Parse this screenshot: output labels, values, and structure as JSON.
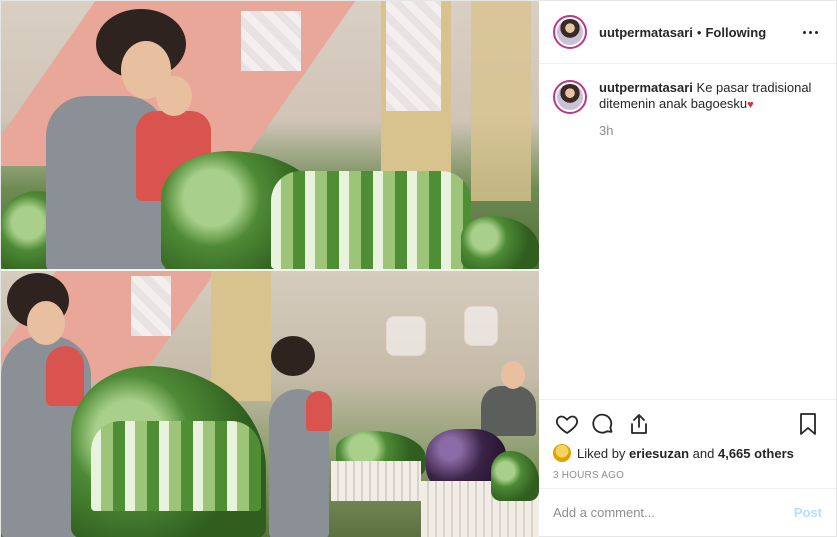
{
  "header": {
    "username": "uutpermatasari",
    "separator": "•",
    "follow_status": "Following",
    "more_icon": "more-horizontal-icon"
  },
  "caption": {
    "username": "uutpermatasari",
    "text": "Ke pasar tradisional ditemenin anak bagoesku",
    "emoji": "heart-icon",
    "time": "3h"
  },
  "actions": {
    "icons": [
      "heart-icon",
      "comment-icon",
      "share-icon",
      "bookmark-icon"
    ]
  },
  "likes": {
    "prefix": "Liked by",
    "liker": "eriesuzan",
    "middle": "and",
    "others": "4,665 others"
  },
  "post_date": "3 HOURS AGO",
  "comment_box": {
    "placeholder": "Add a comment...",
    "post_label": "Post"
  },
  "colors": {
    "text": "#262626",
    "muted": "#8e8e8e",
    "post_disabled": "#b2dffc",
    "border": "#efefef",
    "story_ring": "#c13584"
  }
}
